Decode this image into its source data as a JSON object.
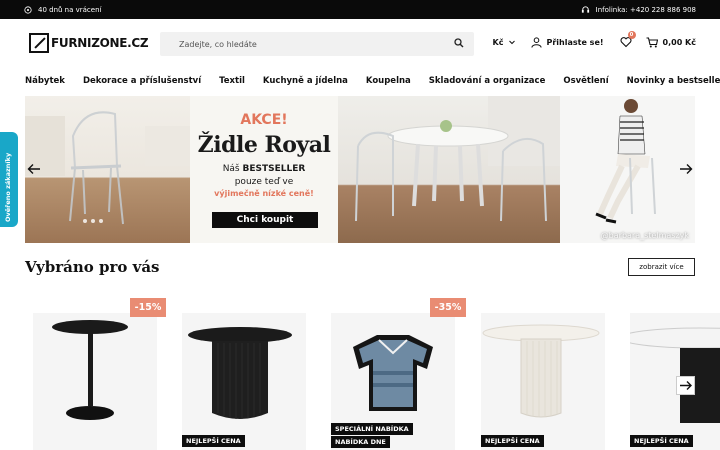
{
  "topbar": {
    "returns_text": "40 dnů na vrácení",
    "infoline_text": "Infolinka: +420 228 886 908"
  },
  "header": {
    "logo_text": "FURNIZONE.CZ",
    "search_placeholder": "Zadejte, co hledáte",
    "currency": "Kč",
    "login_label": "Přihlaste se!",
    "wishlist_count": "0",
    "cart_total": "0,00 Kč"
  },
  "nav": {
    "items": [
      "Nábytek",
      "Dekorace a příslušenství",
      "Textil",
      "Kuchyně a jídelna",
      "Koupelna",
      "Skladování a organizace",
      "Osvětlení",
      "Novinky a bestsellery"
    ]
  },
  "banner": {
    "akce": "AKCE!",
    "title": "Židle Royal",
    "line1_prefix": "Náš",
    "line1_bold": "BESTSELLER",
    "line2": "pouze teď ve",
    "line3": "výjimečně  nízké ceně!",
    "cta": "Chci koupit",
    "credit": "@barbara_stelmaszyk"
  },
  "side_tab": {
    "label": "Ověřeno zákazníky"
  },
  "section": {
    "title": "Vybráno pro vás",
    "more_label": "zobrazit více"
  },
  "products": [
    {
      "discount": "-15%",
      "tags": []
    },
    {
      "discount": "",
      "tags": [
        "NEJLEPŠÍ CENA"
      ]
    },
    {
      "discount": "-35%",
      "tags": [
        "SPECIÁLNÍ NABÍDKA",
        "NABÍDKA DNE"
      ]
    },
    {
      "discount": "",
      "tags": [
        "NEJLEPŠÍ CENA"
      ]
    },
    {
      "discount": "",
      "tags": [
        "NEJLEPŠÍ CENA"
      ]
    }
  ],
  "colors": {
    "accent": "#e2765c",
    "discount_bg": "#e98c73",
    "side_tab": "#19a7c8",
    "topbar": "#0a0a0a"
  }
}
